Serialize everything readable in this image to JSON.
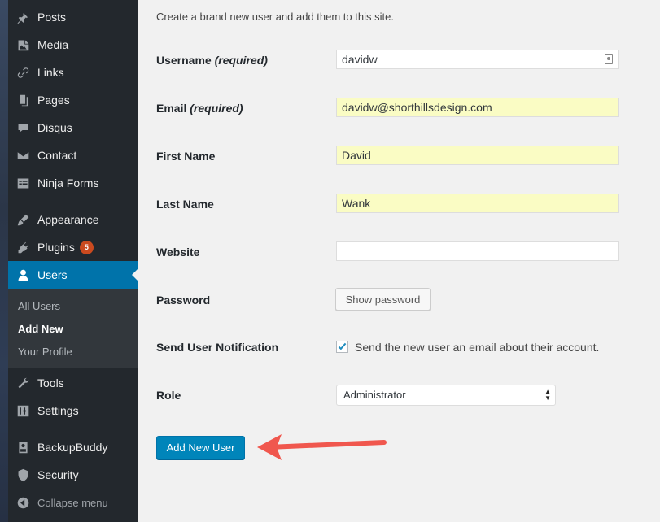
{
  "sidebar": {
    "items": [
      {
        "label": "Posts",
        "icon": "pin-icon"
      },
      {
        "label": "Media",
        "icon": "media-icon"
      },
      {
        "label": "Links",
        "icon": "link-icon"
      },
      {
        "label": "Pages",
        "icon": "pages-icon"
      },
      {
        "label": "Disqus",
        "icon": "comment-icon"
      },
      {
        "label": "Contact",
        "icon": "envelope-icon"
      },
      {
        "label": "Ninja Forms",
        "icon": "form-icon"
      },
      {
        "label": "Appearance",
        "icon": "brush-icon"
      },
      {
        "label": "Plugins",
        "icon": "plugin-icon",
        "badge": "5"
      },
      {
        "label": "Users",
        "icon": "user-icon"
      },
      {
        "label": "Tools",
        "icon": "wrench-icon"
      },
      {
        "label": "Settings",
        "icon": "settings-icon"
      },
      {
        "label": "BackupBuddy",
        "icon": "backup-icon"
      },
      {
        "label": "Security",
        "icon": "shield-icon"
      }
    ],
    "submenu": [
      "All Users",
      "Add New",
      "Your Profile"
    ],
    "collapse_label": "Collapse menu"
  },
  "form": {
    "intro": "Create a brand new user and add them to this site.",
    "username_label": "Username",
    "required": "(required)",
    "username_value": "davidw",
    "email_label": "Email",
    "email_value": "davidw@shorthillsdesign.com",
    "first_name_label": "First Name",
    "first_name_value": "David",
    "last_name_label": "Last Name",
    "last_name_value": "Wank",
    "website_label": "Website",
    "website_value": "",
    "password_label": "Password",
    "show_password": "Show password",
    "notification_label": "Send User Notification",
    "notification_text": "Send the new user an email about their account.",
    "role_label": "Role",
    "role_value": "Administrator",
    "submit": "Add New User"
  },
  "colors": {
    "accent": "#0073aa",
    "button_primary": "#0085ba",
    "autofill": "#fafcc4",
    "annotation_arrow": "#f0574e",
    "badge": "#ca4a1f"
  }
}
